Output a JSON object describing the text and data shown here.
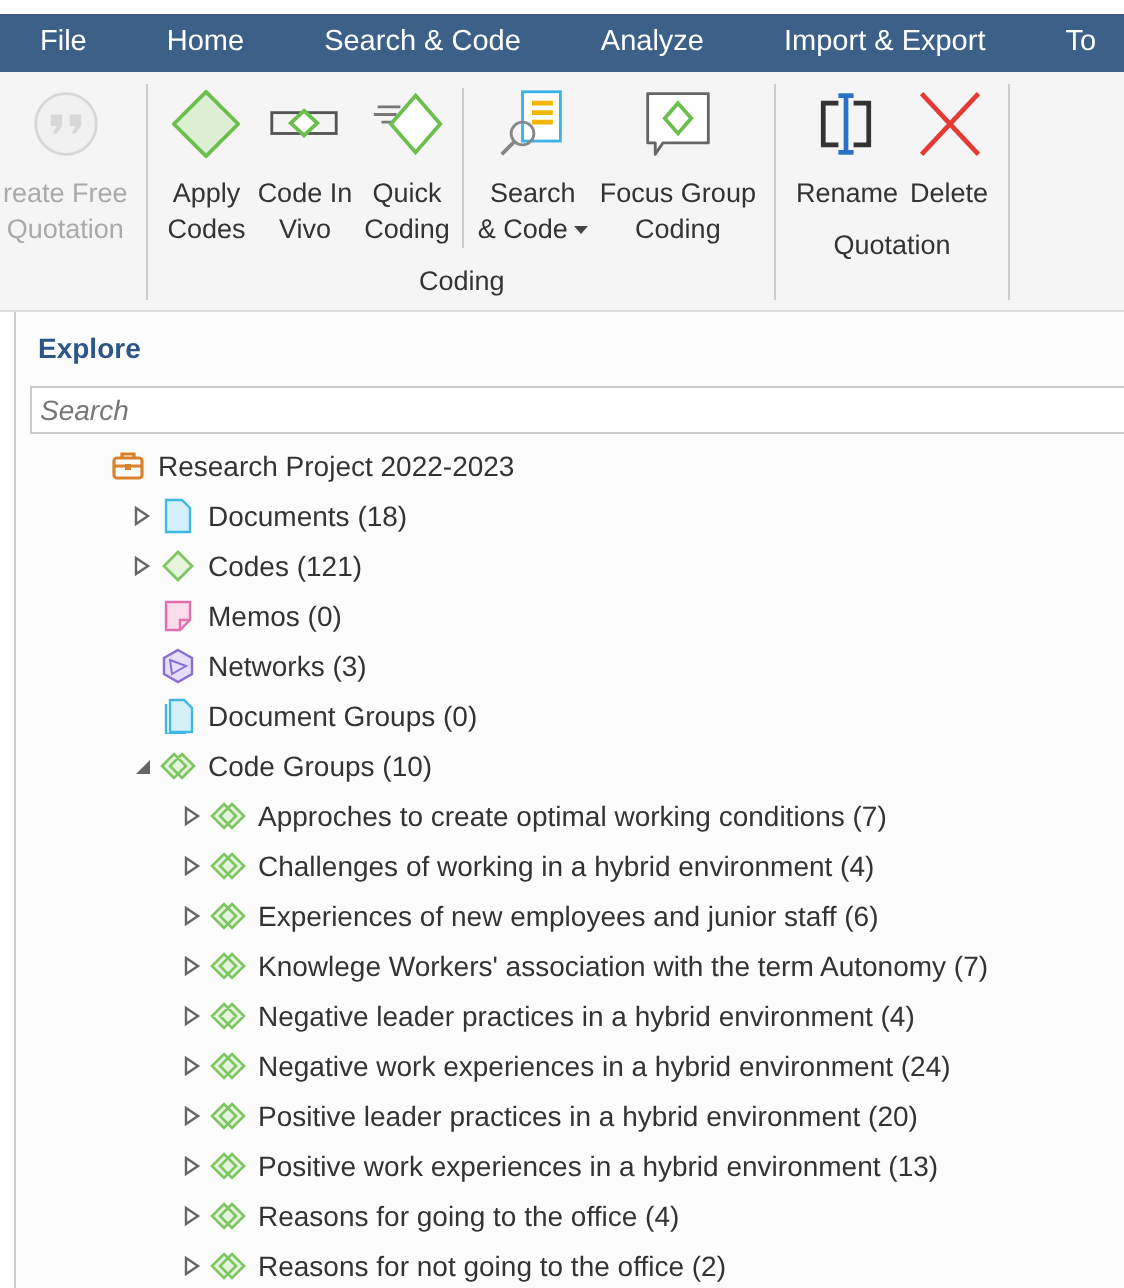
{
  "menu": [
    {
      "label": "File"
    },
    {
      "label": "Home"
    },
    {
      "label": "Search & Code"
    },
    {
      "label": "Analyze"
    },
    {
      "label": "Import & Export"
    },
    {
      "label": "To"
    }
  ],
  "ribbon": [
    {
      "sections": [
        [
          {
            "kind": "quote",
            "lines": [
              "reate Free",
              "Quotation"
            ],
            "disabled": true
          }
        ]
      ]
    },
    {
      "label": "Coding",
      "sections": [
        [
          {
            "kind": "apply",
            "lines": [
              "Apply",
              "Codes"
            ],
            "disabled": false
          },
          {
            "kind": "invivo",
            "lines": [
              "Code In",
              "Vivo"
            ],
            "disabled": false
          },
          {
            "kind": "quick",
            "lines": [
              "Quick",
              "Coding"
            ],
            "disabled": false
          }
        ],
        [
          {
            "kind": "search",
            "lines": [
              "Search",
              "& Code"
            ],
            "dropdown": true,
            "disabled": false
          },
          {
            "kind": "focus",
            "lines": [
              "Focus Group",
              "Coding"
            ],
            "disabled": false
          }
        ]
      ]
    },
    {
      "label": "Quotation",
      "sections": [
        [
          {
            "kind": "rename",
            "lines": [
              "Rename"
            ],
            "disabled": false
          },
          {
            "kind": "delete",
            "lines": [
              "Delete"
            ],
            "disabled": false
          }
        ]
      ]
    }
  ],
  "explore": {
    "title": "Explore",
    "search": {
      "placeholder": "Search"
    },
    "tree": [
      {
        "kind": "project",
        "label": "Research Project 2022-2023",
        "children": [
          {
            "kind": "documents",
            "label": "Documents (18)",
            "expanded": false
          },
          {
            "kind": "codes",
            "label": "Codes (121)",
            "expanded": false
          },
          {
            "kind": "memos",
            "label": "Memos (0)"
          },
          {
            "kind": "networks",
            "label": "Networks (3)"
          },
          {
            "kind": "document-groups",
            "label": "Document Groups (0)"
          },
          {
            "kind": "code-groups",
            "label": "Code Groups (10)",
            "expanded": true,
            "children": [
              {
                "kind": "code-group",
                "label": "Approches to create optimal working conditions (7)",
                "expanded": false
              },
              {
                "kind": "code-group",
                "label": "Challenges of working in a hybrid environment (4)",
                "expanded": false
              },
              {
                "kind": "code-group",
                "label": "Experiences of new employees and junior staff (6)",
                "expanded": false
              },
              {
                "kind": "code-group",
                "label": "Knowlege Workers' association with the term Autonomy (7)",
                "expanded": false
              },
              {
                "kind": "code-group",
                "label": "Negative leader practices in a hybrid environment (4)",
                "expanded": false
              },
              {
                "kind": "code-group",
                "label": "Negative work experiences in a hybrid environment (24)",
                "expanded": false
              },
              {
                "kind": "code-group",
                "label": "Positive leader practices in a hybrid environment (20)",
                "expanded": false
              },
              {
                "kind": "code-group",
                "label": "Positive work experiences in a hybrid environment (13)",
                "expanded": false
              },
              {
                "kind": "code-group",
                "label": "Reasons for going to the office (4)",
                "expanded": false
              },
              {
                "kind": "code-group",
                "label": "Reasons for not going to the office (2)",
                "expanded": false
              }
            ]
          }
        ]
      }
    ]
  }
}
